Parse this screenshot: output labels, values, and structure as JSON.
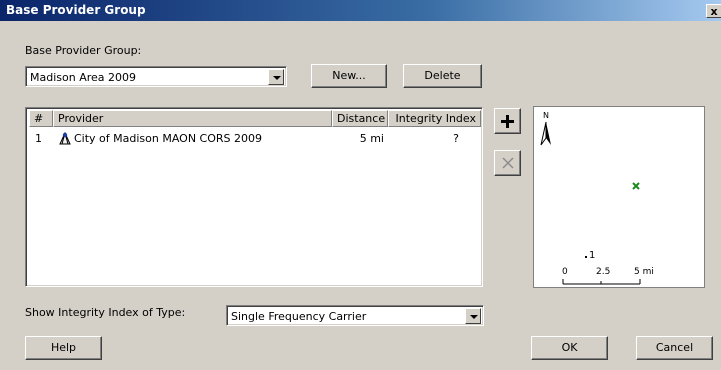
{
  "window": {
    "title": "Base Provider Group",
    "close_label": "x"
  },
  "group": {
    "label": "Base Provider Group:",
    "selected": "Madison Area 2009",
    "new_label": "New...",
    "delete_label": "Delete"
  },
  "table": {
    "columns": [
      "#",
      "Provider",
      "Distance",
      "Integrity Index"
    ],
    "rows": [
      {
        "num": "1",
        "provider": "City of Madison MAON CORS 2009",
        "distance": "5 mi",
        "integrity": "?"
      }
    ]
  },
  "side_buttons": {
    "add_icon": "plus-icon",
    "remove_icon": "x-icon"
  },
  "map": {
    "north_label": "N",
    "point_label": "1",
    "scale_labels": [
      "0",
      "2.5",
      "5 mi"
    ],
    "marker_color": "#1a8a1a"
  },
  "integrity": {
    "label": "Show Integrity Index of Type:",
    "selected": "Single Frequency Carrier"
  },
  "footer": {
    "help_label": "Help",
    "ok_label": "OK",
    "cancel_label": "Cancel"
  }
}
